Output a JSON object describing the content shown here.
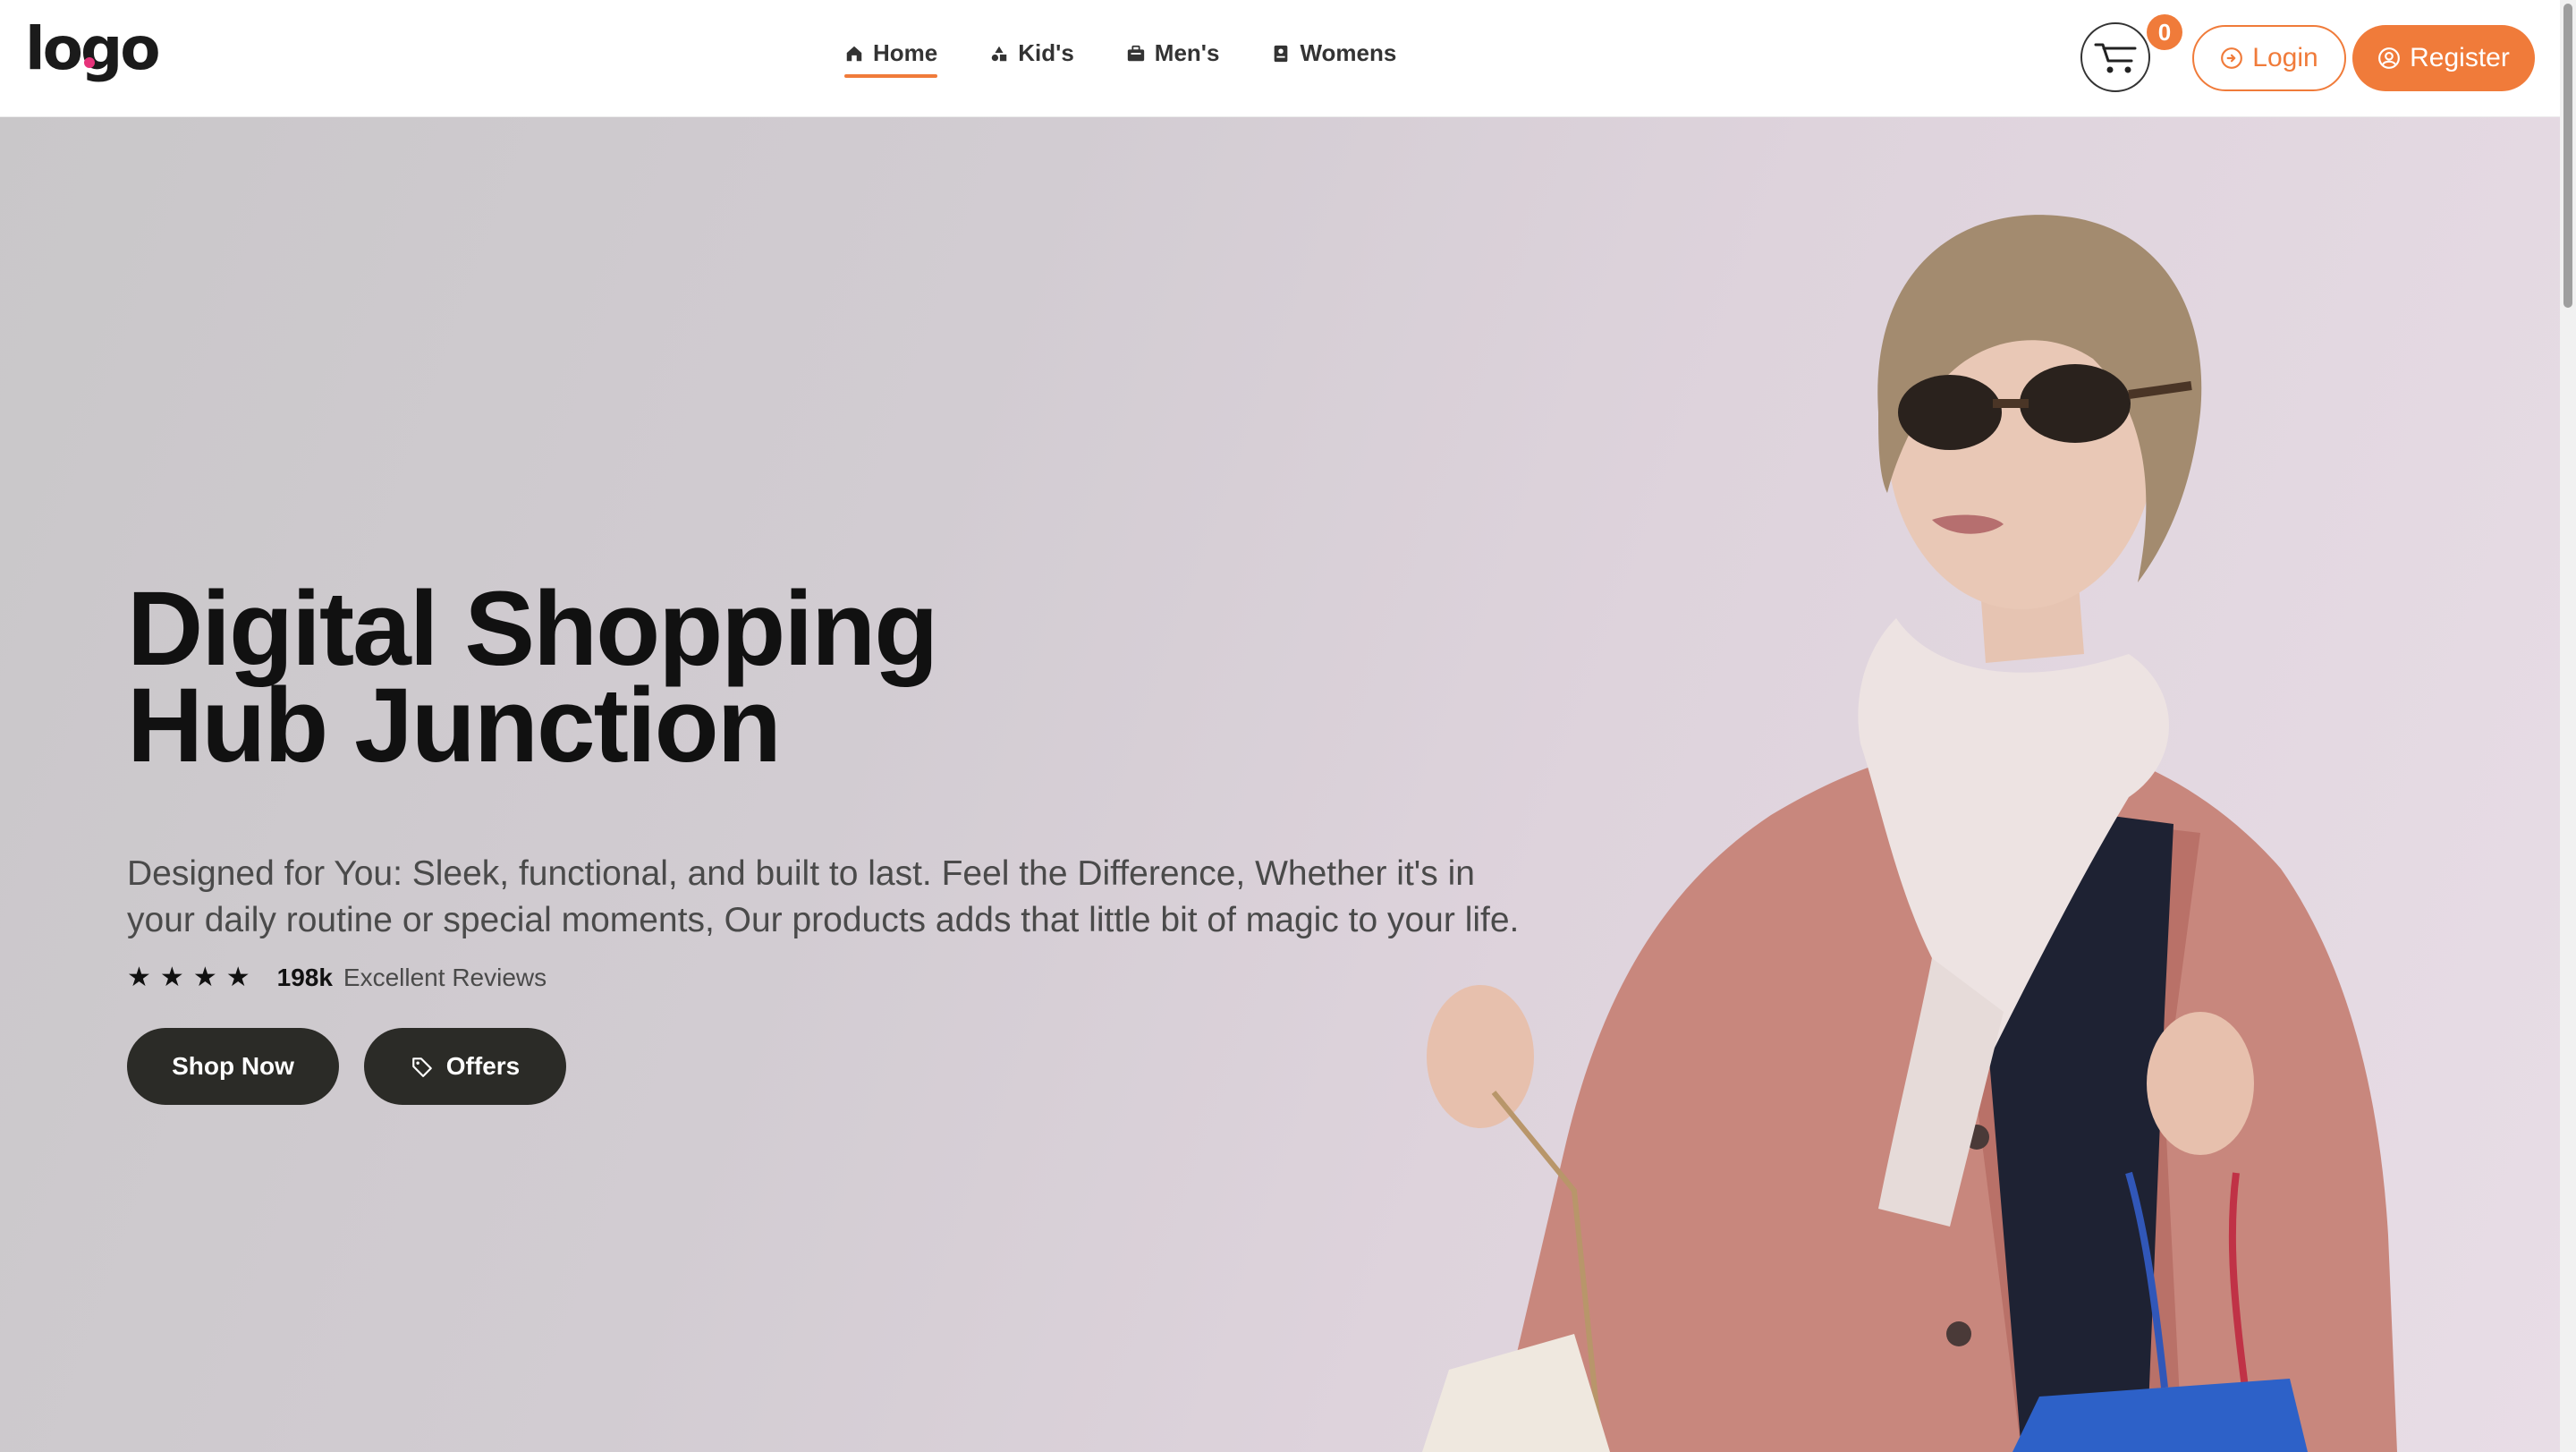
{
  "brand": {
    "logo_text": "logo"
  },
  "nav": {
    "items": [
      {
        "label": "Home",
        "icon": "home-icon",
        "active": true
      },
      {
        "label": "Kid's",
        "icon": "shapes-icon",
        "active": false
      },
      {
        "label": "Men's",
        "icon": "briefcase-icon",
        "active": false
      },
      {
        "label": "Womens",
        "icon": "id-card-icon",
        "active": false
      }
    ]
  },
  "cart": {
    "count": "0",
    "icon": "cart-icon"
  },
  "auth": {
    "login_label": "Login",
    "register_label": "Register"
  },
  "hero": {
    "title_line1": "Digital Shopping",
    "title_line2": "Hub Junction",
    "description": "Designed for You: Sleek, functional, and built to last. Feel the Difference, Whether it's in your daily routine or special moments, Our products adds that little bit of magic to your life.",
    "rating": {
      "stars": 4,
      "count": "198k",
      "label": "Excellent Reviews"
    },
    "shop_button": "Shop Now",
    "offers_button": "Offers"
  },
  "colors": {
    "accent": "#f07b3a",
    "dark_button": "#2b2b27",
    "title": "#111111"
  }
}
